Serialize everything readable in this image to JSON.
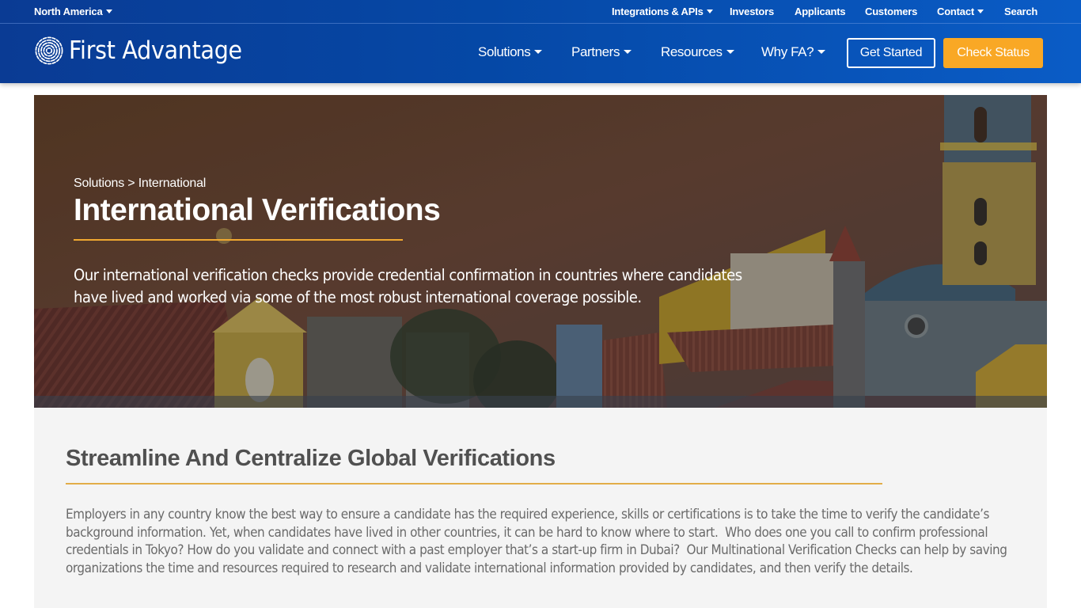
{
  "header": {
    "region_selector": "North America",
    "utility_nav": [
      {
        "label": "Integrations & APIs",
        "has_dropdown": true
      },
      {
        "label": "Investors",
        "has_dropdown": false
      },
      {
        "label": "Applicants",
        "has_dropdown": false
      },
      {
        "label": "Customers",
        "has_dropdown": false
      },
      {
        "label": "Contact",
        "has_dropdown": true
      },
      {
        "label": "Search",
        "has_dropdown": false
      }
    ],
    "logo_text": "First Advantage",
    "logo_icon": "fingerprint-icon",
    "main_nav": [
      {
        "label": "Solutions",
        "has_dropdown": true
      },
      {
        "label": "Partners",
        "has_dropdown": true
      },
      {
        "label": "Resources",
        "has_dropdown": true
      },
      {
        "label": "Why FA?",
        "has_dropdown": true
      }
    ],
    "get_started_label": "Get Started",
    "check_status_label": "Check Status",
    "colors": {
      "header_blue": "#0548a6",
      "accent_orange": "#f9a825"
    }
  },
  "hero": {
    "breadcrumb": {
      "parent": "Solutions",
      "separator": ">",
      "current": "International"
    },
    "title": "International Verifications",
    "description": "Our international verification checks provide credential confirmation in countries where candidates have lived and worked via some of the most robust international coverage possible.",
    "background": "cityscape-photo-colonial-rooftops-and-bell-tower-at-dusk",
    "rule_color": "#f0a830"
  },
  "section": {
    "title": "Streamline And Centralize Global Verifications",
    "body": "Employers in any country know the best way to ensure a candidate has the required experience, skills or certifications is to take the time to verify the candidate’s background information. Yet, when candidates have lived in other countries, it can be hard to know where to start.  Who does one you call to confirm professional credentials in Tokyo? How do you validate and connect with a past employer that’s a start-up firm in Dubai?  Our Multinational Verification Checks can help by saving organizations the time and resources required to research and validate international information provided by candidates, and then verify the details.",
    "rule_color": "#e2ad48"
  }
}
